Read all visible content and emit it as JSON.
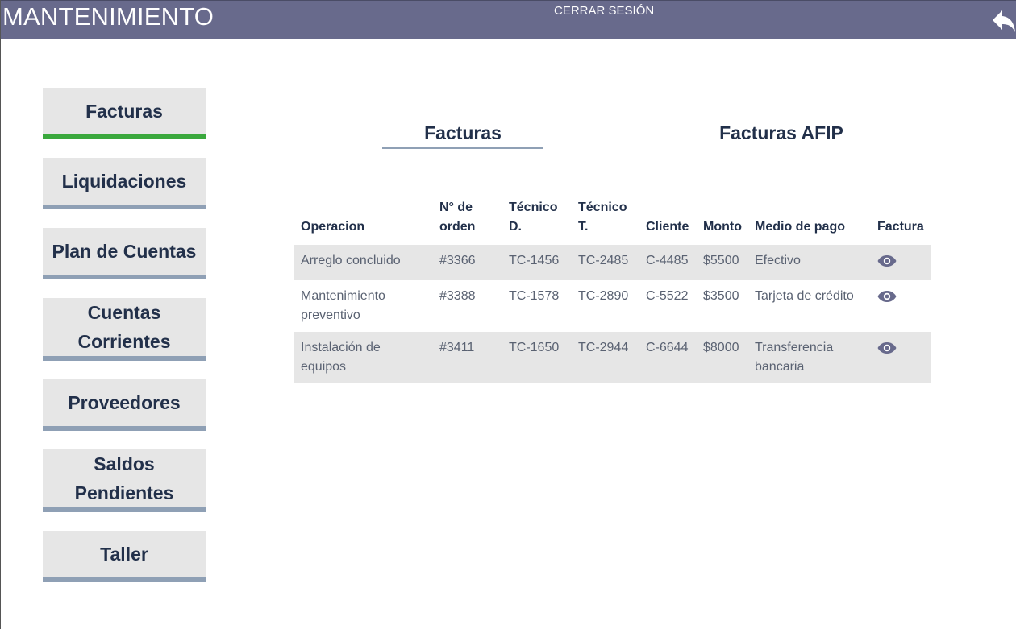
{
  "header": {
    "title": "MANTENIMIENTO",
    "logout_label": "CERRAR SESIÓN",
    "back_icon": "reply-arrow-icon"
  },
  "colors": {
    "topbar": "#686a8c",
    "text": "#22304a",
    "active_underline": "#3aa83d",
    "inactive_underline": "#8fa0b5",
    "button_bg": "#e6e6e6"
  },
  "sidebar": {
    "items": [
      {
        "label": "Facturas",
        "active": true
      },
      {
        "label": "Liquidaciones",
        "active": false
      },
      {
        "label": "Plan de Cuentas",
        "active": false
      },
      {
        "label": "Cuentas Corrientes",
        "active": false
      },
      {
        "label": "Proveedores",
        "active": false
      },
      {
        "label": "Saldos Pendientes",
        "active": false
      },
      {
        "label": "Taller",
        "active": false
      }
    ]
  },
  "tabs": [
    {
      "label": "Facturas",
      "active": true
    },
    {
      "label": "Facturas AFIP",
      "active": false
    }
  ],
  "table": {
    "columns": [
      "Operacion",
      "N° de orden",
      "Técnico D.",
      "Técnico T.",
      "Cliente",
      "Monto",
      "Medio de pago",
      "Factura"
    ],
    "rows": [
      {
        "operacion": "Arreglo concluido",
        "orden": "#3366",
        "tecnico_d": "TC-1456",
        "tecnico_t": "TC-2485",
        "cliente": "C-4485",
        "monto": "$5500",
        "medio_pago": "Efectivo",
        "factura_icon": "eye-icon"
      },
      {
        "operacion": "Mantenimiento preventivo",
        "orden": "#3388",
        "tecnico_d": "TC-1578",
        "tecnico_t": "TC-2890",
        "cliente": "C-5522",
        "monto": "$3500",
        "medio_pago": "Tarjeta de crédito",
        "factura_icon": "eye-icon"
      },
      {
        "operacion": "Instalación de equipos",
        "orden": "#3411",
        "tecnico_d": "TC-1650",
        "tecnico_t": "TC-2944",
        "cliente": "C-6644",
        "monto": "$8000",
        "medio_pago": "Transferencia bancaria",
        "factura_icon": "eye-icon"
      }
    ]
  }
}
